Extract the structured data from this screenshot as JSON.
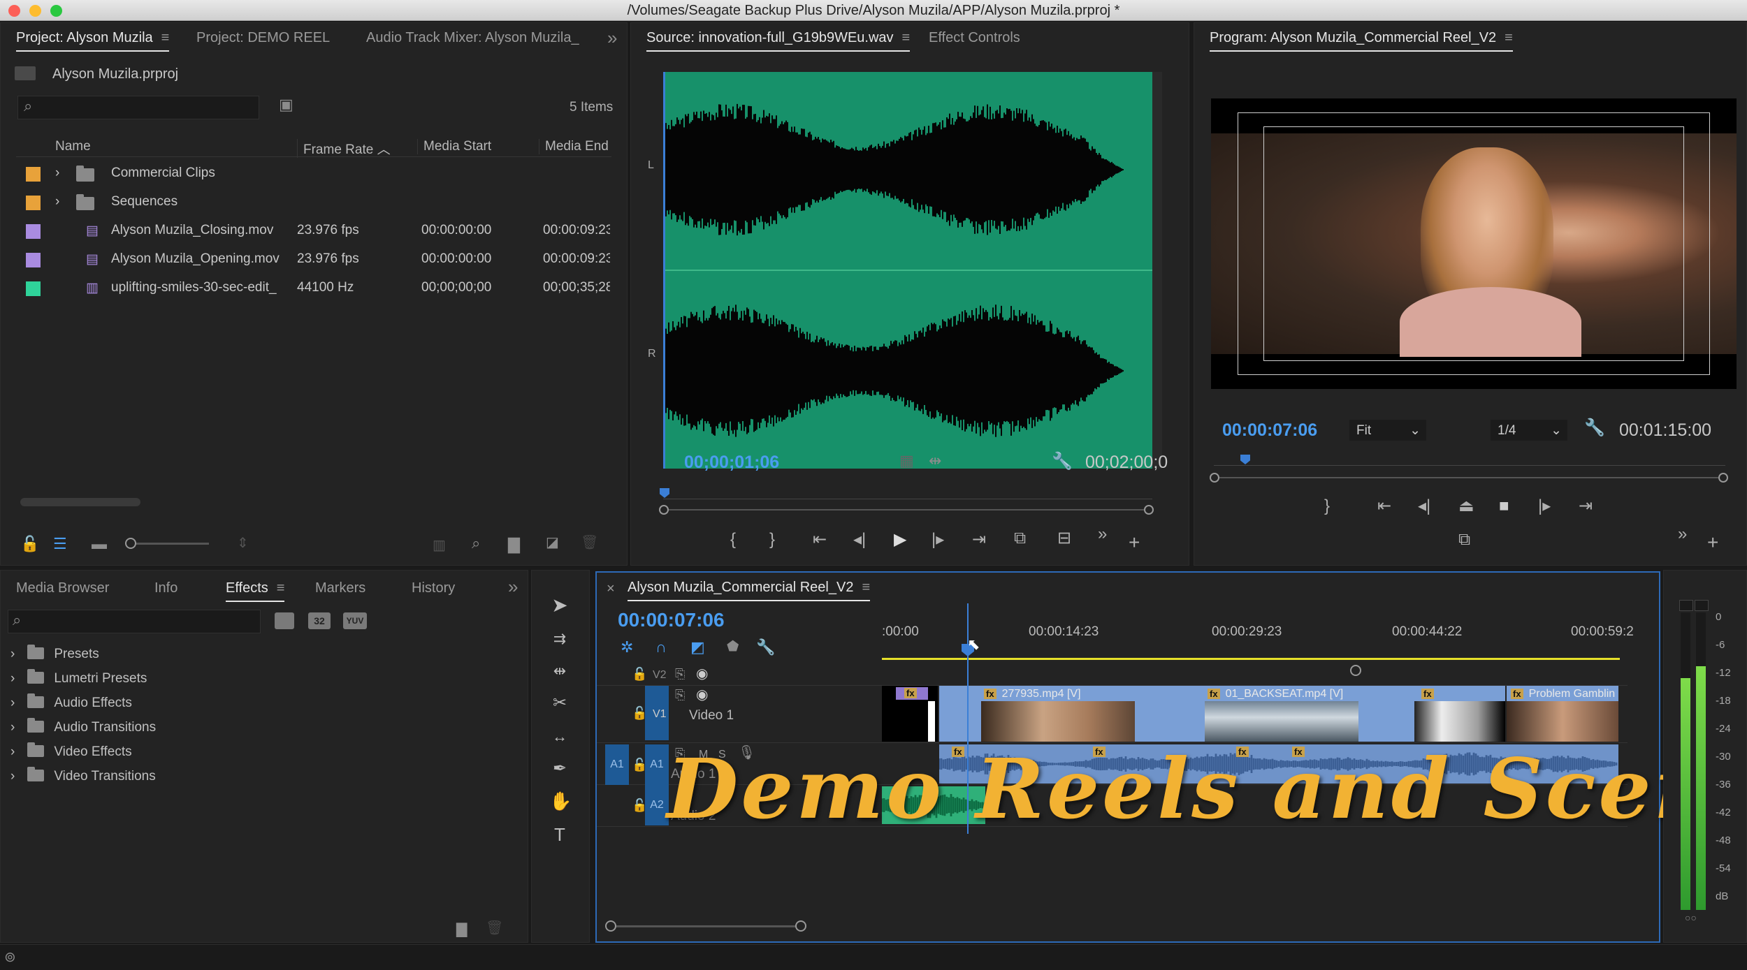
{
  "window_title": "/Volumes/Seagate Backup Plus Drive/Alyson Muzila/APP/Alyson Muzila.prproj *",
  "project_panel": {
    "tabs": [
      "Project: Alyson Muzila",
      "Project: DEMO REEL",
      "Audio Track Mixer: Alyson Muzila_C"
    ],
    "project_file": "Alyson Muzila.prproj",
    "items_count": "5 Items",
    "columns": [
      "Name",
      "Frame Rate",
      "Media Start",
      "Media End"
    ],
    "rows": [
      {
        "name": "Commercial Clips",
        "frame_rate": "",
        "start": "",
        "end": "",
        "color": "#e8a23a"
      },
      {
        "name": "Sequences",
        "frame_rate": "",
        "start": "",
        "end": "",
        "color": "#e8a23a"
      },
      {
        "name": "Alyson Muzila_Closing.mov",
        "frame_rate": "23.976 fps",
        "start": "00:00:00:00",
        "end": "00:00:09:23",
        "color": "#a98be0"
      },
      {
        "name": "Alyson Muzila_Opening.mov",
        "frame_rate": "23.976 fps",
        "start": "00:00:00:00",
        "end": "00:00:09:23",
        "color": "#a98be0"
      },
      {
        "name": "uplifting-smiles-30-sec-edit_",
        "frame_rate": "44100 Hz",
        "start": "00;00;00;00",
        "end": "00;00;35;28",
        "color": "#2fd39a"
      }
    ]
  },
  "source_monitor": {
    "tabs": [
      "Source: innovation-full_G19b9WEu.wav",
      "Effect Controls"
    ],
    "channel_left": "L",
    "channel_right": "R",
    "current_time": "00;00;01;06",
    "duration": "00;02;00;0"
  },
  "program_monitor": {
    "title": "Program: Alyson Muzila_Commercial Reel_V2",
    "current_time": "00:00:07:06",
    "zoom": "Fit",
    "resolution": "1/4",
    "duration": "00:01:15:00"
  },
  "effects_panel": {
    "tabs": [
      "Media Browser",
      "Info",
      "Effects",
      "Markers",
      "History"
    ],
    "items": [
      "Presets",
      "Lumetri Presets",
      "Audio Effects",
      "Audio Transitions",
      "Video Effects",
      "Video Transitions"
    ],
    "badges": [
      "32",
      "YUV"
    ]
  },
  "timeline": {
    "sequence_name": "Alyson Muzila_Commercial Reel_V2",
    "current_time": "00:00:07:06",
    "ruler": [
      ":00:00",
      "00:00:14:23",
      "00:00:29:23",
      "00:00:44:22",
      "00:00:59:2"
    ],
    "tracks": {
      "v2": "V2",
      "v1": "V1",
      "v1_name": "Video 1",
      "a1": "A1",
      "a1_name": "Audio 1",
      "a2": "A2",
      "a2_name": "Audio 2",
      "m": "M",
      "s": "S"
    },
    "clips": [
      "277935.mp4 [V]",
      "01_BACKSEAT.mp4 [V]",
      "Problem Gamblin"
    ],
    "fx_label": "fx"
  },
  "audio_meter": {
    "scale": [
      "0",
      "-6",
      "-12",
      "-18",
      "-24",
      "-30",
      "-36",
      "-42",
      "-48",
      "-54",
      "dB"
    ],
    "left_level": 0.78,
    "right_level": 0.82
  },
  "overlay_text": "Demo Reels and Scenes",
  "colors": {
    "accent_blue": "#4a9df0",
    "waveform_bg": "#17916a",
    "clip_blue": "#7a9fd6",
    "playhead_yellow": "#e6e02a",
    "overlay_gold": "#f2b233"
  }
}
